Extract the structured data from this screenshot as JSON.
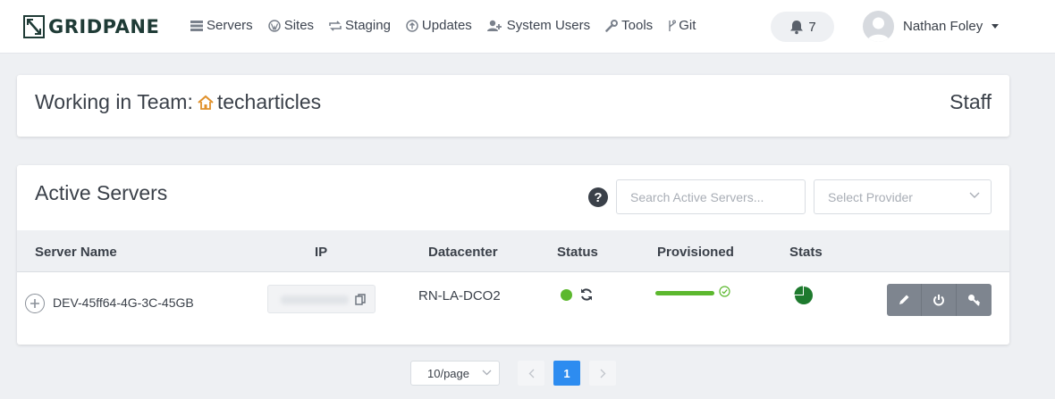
{
  "app": {
    "logo_text": "GRIDPANE",
    "nav": [
      {
        "label": "Servers",
        "icon": "servers-icon"
      },
      {
        "label": "Sites",
        "icon": "wordpress-icon"
      },
      {
        "label": "Staging",
        "icon": "staging-icon"
      },
      {
        "label": "Updates",
        "icon": "updates-icon"
      },
      {
        "label": "System Users",
        "icon": "users-icon"
      },
      {
        "label": "Tools",
        "icon": "wrench-icon"
      },
      {
        "label": "Git",
        "icon": "git-icon"
      }
    ],
    "notifications_count": "7",
    "user_name": "Nathan Foley"
  },
  "team": {
    "prefix": "Working in Team:",
    "name": "techarticles",
    "role": "Staff"
  },
  "servers": {
    "title": "Active Servers",
    "help_label": "?",
    "search_placeholder": "Search Active Servers...",
    "provider_placeholder": "Select Provider",
    "columns": [
      "Server Name",
      "IP",
      "Datacenter",
      "Status",
      "Provisioned",
      "Stats"
    ],
    "rows": [
      {
        "name": "DEV-45ff64-4G-3C-45GB",
        "datacenter": "RN-LA-DCO2",
        "status_color": "#5cb82e",
        "provisioned": 1.0
      }
    ]
  },
  "pagination": {
    "page_size": "10/page",
    "current_page": "1"
  },
  "colors": {
    "accent": "#2d8cf0",
    "success": "#5cb82e",
    "stats_pie": "#1e7a2e",
    "action_button": "#7e858f"
  }
}
